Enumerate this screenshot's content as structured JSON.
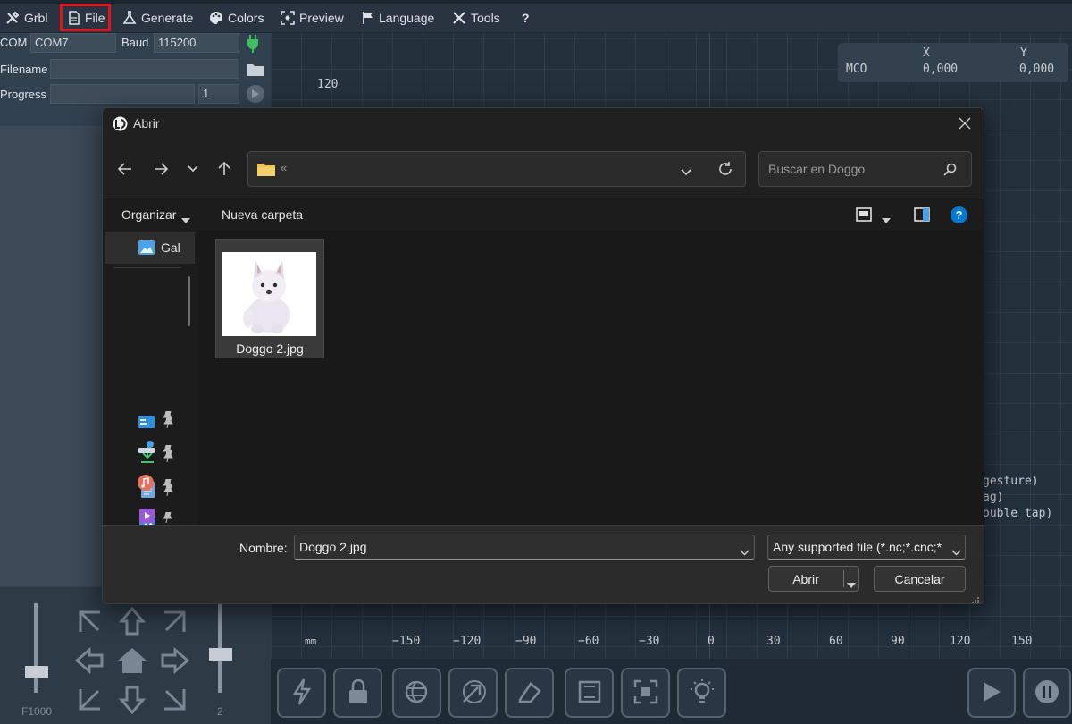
{
  "menu": {
    "items": [
      {
        "label": "Grbl",
        "icon": "tools-icon"
      },
      {
        "label": "File",
        "icon": "file-icon"
      },
      {
        "label": "Generate",
        "icon": "flask-icon"
      },
      {
        "label": "Colors",
        "icon": "palette-icon"
      },
      {
        "label": "Preview",
        "icon": "preview-icon"
      },
      {
        "label": "Language",
        "icon": "flag-icon"
      },
      {
        "label": "Tools",
        "icon": "wrench-icon"
      },
      {
        "label": "?",
        "icon": "help-icon"
      }
    ],
    "highlight_color": "#e0141a"
  },
  "left_panel": {
    "com_label": "COM",
    "com_value": "COM7",
    "baud_label": "Baud",
    "baud_value": "115200",
    "filename_label": "Filename",
    "filename_value": "",
    "progress_label": "Progress",
    "progress_value": "1",
    "feed_label": "F1000",
    "step_label": "2"
  },
  "canvas": {
    "y_tick": "120",
    "coords": {
      "row_label": "MCO",
      "x_header": "X",
      "y_header": "Y",
      "x_value": "0,000",
      "y_value": "0,000"
    },
    "hints": [
      "gesture)",
      "ag)",
      "ouble tap)"
    ],
    "x_unit": "mm",
    "x_ticks": [
      "−150",
      "−120",
      "−90",
      "−60",
      "−30",
      "0",
      "30",
      "60",
      "90",
      "120",
      "150"
    ]
  },
  "dialog": {
    "title": "Abrir",
    "search_placeholder": "Buscar en Doggo",
    "address_path": "«",
    "organize_label": "Organizar",
    "new_folder_label": "Nueva carpeta",
    "nav_items": [
      {
        "label": "Gal",
        "icon": "gallery-icon"
      },
      {
        "label": "",
        "icon": "desktop-icon"
      },
      {
        "label": "",
        "icon": "download-icon"
      },
      {
        "label": "",
        "icon": "documents-icon"
      },
      {
        "label": "",
        "icon": "pictures-icon"
      },
      {
        "label": "",
        "icon": "network-drive-icon"
      },
      {
        "label": "",
        "icon": "music-icon"
      },
      {
        "label": "",
        "icon": "videos-icon"
      }
    ],
    "files": [
      {
        "name": "Doggo 2.jpg"
      }
    ],
    "filename_label": "Nombre:",
    "filename_value": "Doggo 2.jpg",
    "filetype_value": "Any supported file (*.nc;*.cnc;*",
    "open_label": "Abrir",
    "cancel_label": "Cancelar",
    "accent": "#0078d4"
  }
}
